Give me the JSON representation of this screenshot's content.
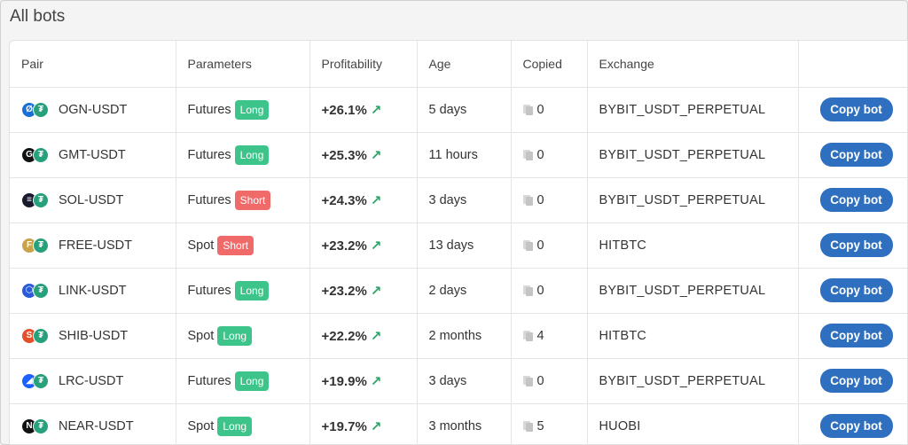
{
  "page": {
    "title": "All bots"
  },
  "table": {
    "headers": [
      "Pair",
      "Parameters",
      "Profitability",
      "Age",
      "Copied",
      "Exchange",
      ""
    ],
    "rows": [
      {
        "pair": "OGN-USDT",
        "base_icon": "ogn-icon",
        "base_color": "#1a6fd6",
        "base_glyph": "Ø",
        "market": "Futures",
        "direction": "Long",
        "profit": "+26.1%",
        "age": "5 days",
        "copied": "0",
        "exchange": "BYBIT_USDT_PERPETUAL",
        "button": "Copy bot"
      },
      {
        "pair": "GMT-USDT",
        "base_icon": "gmt-icon",
        "base_color": "#111111",
        "base_glyph": "G",
        "market": "Futures",
        "direction": "Long",
        "profit": "+25.3%",
        "age": "11 hours",
        "copied": "0",
        "exchange": "BYBIT_USDT_PERPETUAL",
        "button": "Copy bot"
      },
      {
        "pair": "SOL-USDT",
        "base_icon": "sol-icon",
        "base_color": "#1a1a2e",
        "base_glyph": "≡",
        "market": "Futures",
        "direction": "Short",
        "profit": "+24.3%",
        "age": "3 days",
        "copied": "0",
        "exchange": "BYBIT_USDT_PERPETUAL",
        "button": "Copy bot"
      },
      {
        "pair": "FREE-USDT",
        "base_icon": "free-icon",
        "base_color": "#c9a24a",
        "base_glyph": "F",
        "market": "Spot",
        "direction": "Short",
        "profit": "+23.2%",
        "age": "13 days",
        "copied": "0",
        "exchange": "HITBTC",
        "button": "Copy bot"
      },
      {
        "pair": "LINK-USDT",
        "base_icon": "link-icon",
        "base_color": "#2a5ada",
        "base_glyph": "⬡",
        "market": "Futures",
        "direction": "Long",
        "profit": "+23.2%",
        "age": "2 days",
        "copied": "0",
        "exchange": "BYBIT_USDT_PERPETUAL",
        "button": "Copy bot"
      },
      {
        "pair": "SHIB-USDT",
        "base_icon": "shib-icon",
        "base_color": "#e5502b",
        "base_glyph": "S",
        "market": "Spot",
        "direction": "Long",
        "profit": "+22.2%",
        "age": "2 months",
        "copied": "4",
        "exchange": "HITBTC",
        "button": "Copy bot"
      },
      {
        "pair": "LRC-USDT",
        "base_icon": "lrc-icon",
        "base_color": "#1c60ff",
        "base_glyph": "◢",
        "market": "Futures",
        "direction": "Long",
        "profit": "+19.9%",
        "age": "3 days",
        "copied": "0",
        "exchange": "BYBIT_USDT_PERPETUAL",
        "button": "Copy bot"
      },
      {
        "pair": "NEAR-USDT",
        "base_icon": "near-icon",
        "base_color": "#111111",
        "base_glyph": "N",
        "market": "Spot",
        "direction": "Long",
        "profit": "+19.7%",
        "age": "3 months",
        "copied": "5",
        "exchange": "HUOBI",
        "button": "Copy bot"
      }
    ]
  },
  "icons": {
    "quote": "usdt-icon",
    "quote_glyph": "₮",
    "trend": "arrow-up-right-icon",
    "copies": "copy-icon"
  },
  "colors": {
    "long": "#3dc48a",
    "short": "#f06a6a",
    "button": "#2f6fc0",
    "trend": "#2aa466"
  }
}
